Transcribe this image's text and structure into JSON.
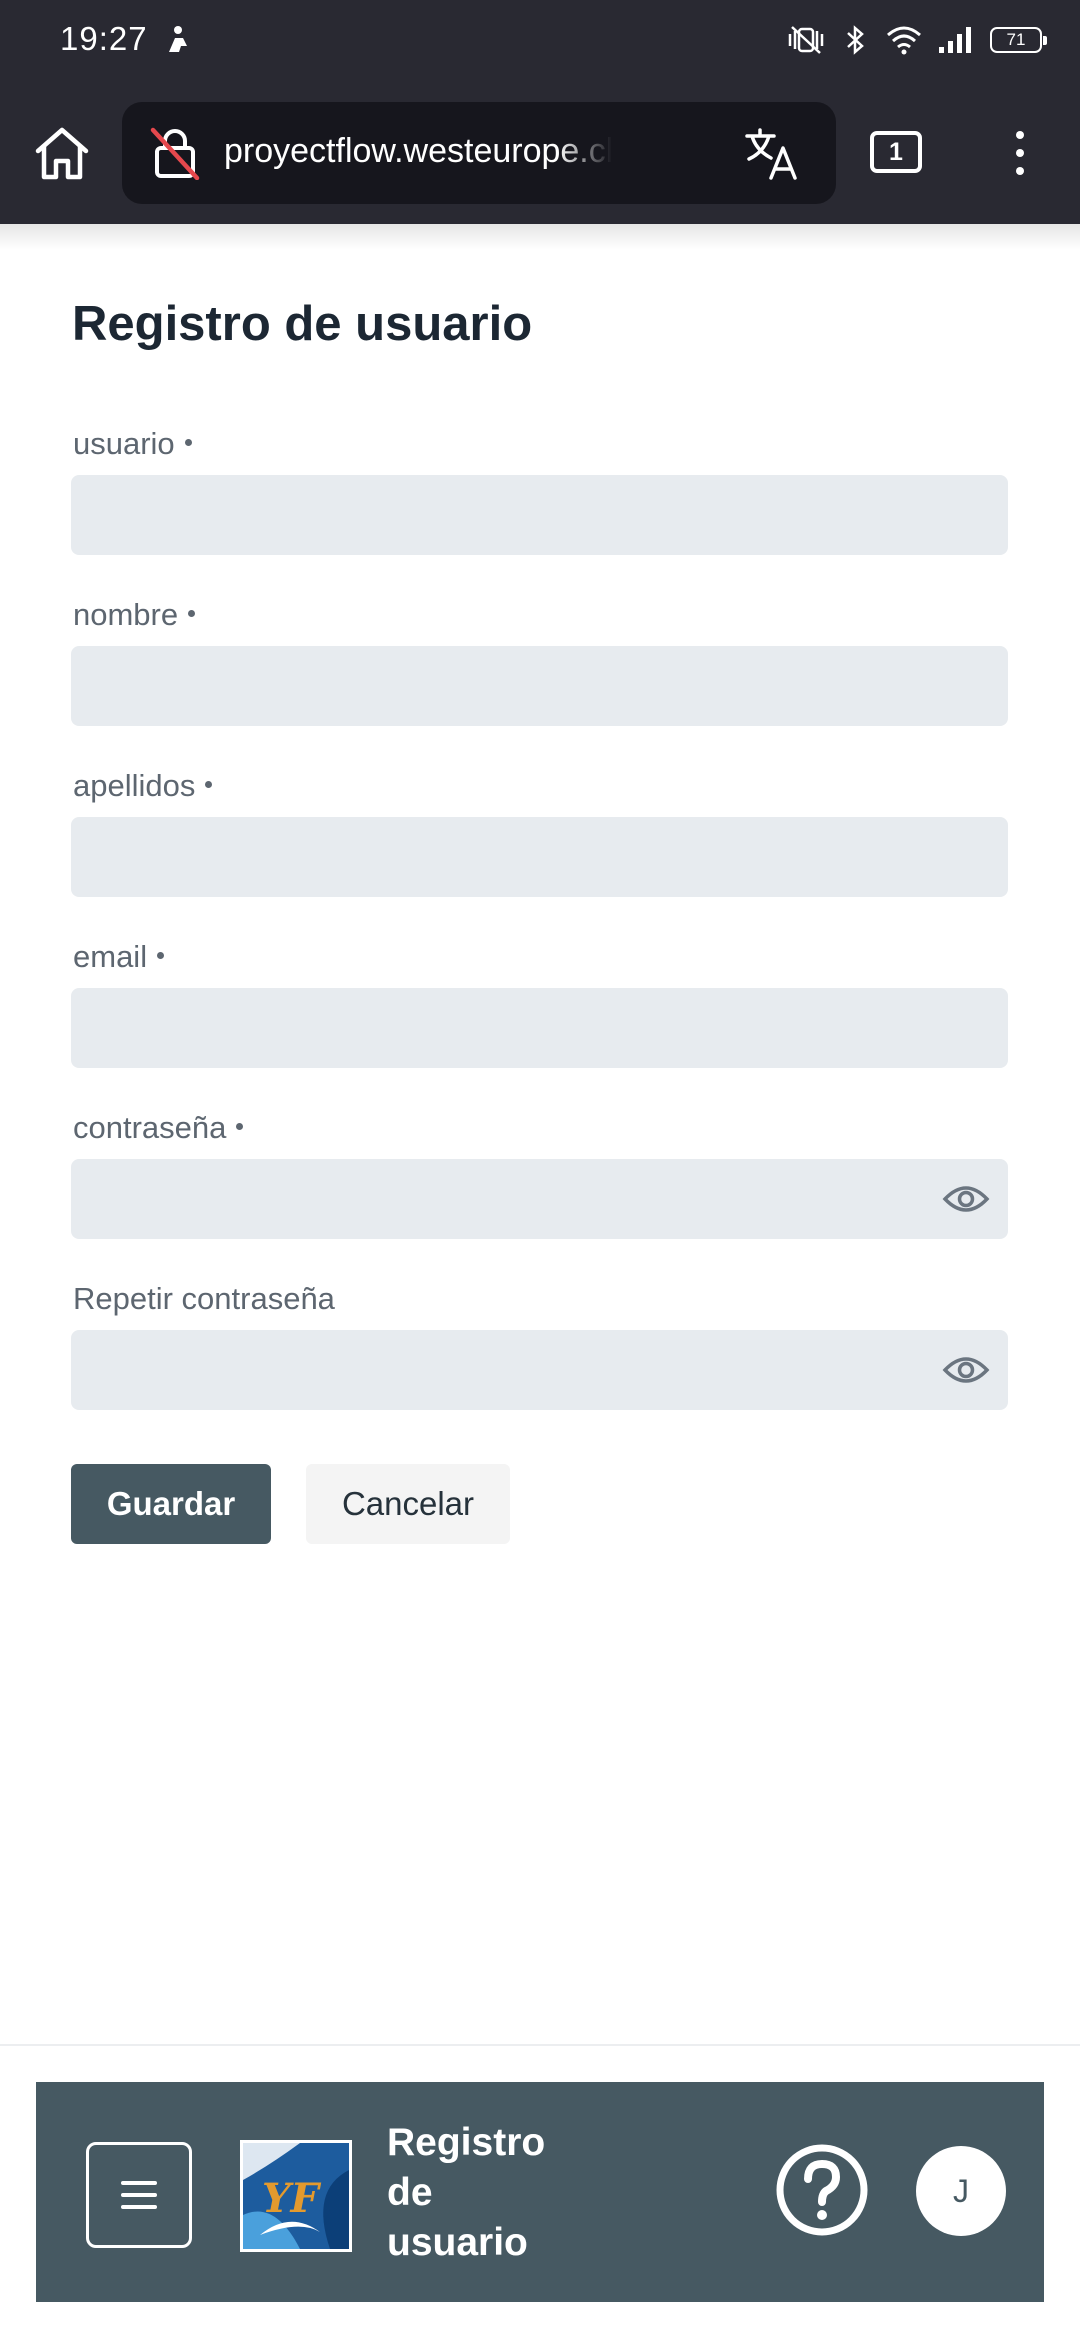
{
  "status_bar": {
    "time": "19:27",
    "battery": "71"
  },
  "browser": {
    "url": "proyectflow.westeurope.cloudapp.azure.com",
    "tab_count": "1"
  },
  "form": {
    "title": "Registro de usuario",
    "fields": [
      {
        "label": "usuario",
        "required": true,
        "value": ""
      },
      {
        "label": "nombre",
        "required": true,
        "value": ""
      },
      {
        "label": "apellidos",
        "required": true,
        "value": ""
      },
      {
        "label": "email",
        "required": true,
        "value": ""
      },
      {
        "label": "contraseña",
        "required": true,
        "value": ""
      },
      {
        "label": "Repetir contraseña",
        "required": false,
        "value": ""
      }
    ],
    "save_label": "Guardar",
    "cancel_label": "Cancelar"
  },
  "app_bar": {
    "title_lines": [
      "Registro",
      "de",
      "usuario"
    ],
    "avatar_initial": "J",
    "logo_text": "YF"
  },
  "icons": {
    "home": "home-icon",
    "lock": "lock-off-icon",
    "translate": "translate-icon",
    "tabs": "tabs-icon",
    "menu": "more-vert-icon",
    "eye": "eye-icon",
    "hamburger": "hamburger-menu-icon",
    "help": "help-circle-icon"
  },
  "colors": {
    "status_bar": "#292932",
    "url_bar": "#16161d",
    "primary": "#465962",
    "input_bg": "#e7ebef",
    "title_text": "#1c2733",
    "label_text": "#5d6670"
  }
}
